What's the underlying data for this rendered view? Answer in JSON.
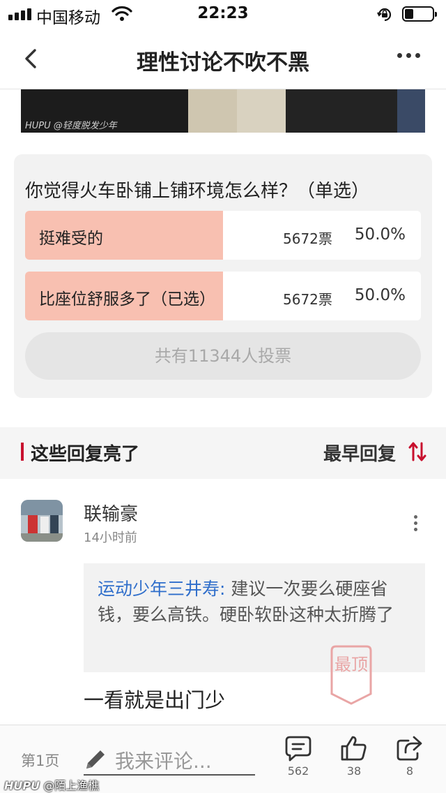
{
  "status_bar": {
    "carrier": "中国移动",
    "time": "22:23",
    "icons": [
      "signal-icon",
      "wifi-icon",
      "rotation-lock-icon",
      "battery-icon"
    ]
  },
  "navbar": {
    "title": "理性讨论不吹不黑",
    "icons": [
      "back-arrow-icon",
      "more-dots-icon"
    ]
  },
  "post_image": {
    "watermark": "HUPU @轻度脱发少年"
  },
  "poll": {
    "question": "你觉得火车卧铺上铺环境怎么样？（单选）",
    "bar_color": "#f8c0b1",
    "options": [
      {
        "label": "挺难受的",
        "votes": "5672票",
        "percent": "50.0%",
        "fraction": 0.5
      },
      {
        "label": "比座位舒服多了（已选）",
        "votes": "5672票",
        "percent": "50.0%",
        "fraction": 0.5
      }
    ],
    "total": "共有11344人投票"
  },
  "section": {
    "title": "这些回复亮了",
    "sort_label": "最早回复",
    "accent": "#c8102e"
  },
  "comment": {
    "user": "联输豪",
    "time": "14小时前",
    "quote_author": "运动少年三井寿:",
    "quote_text": " 建议一次要么硬座省钱，要么高铁。硬卧软卧这种太折腾了",
    "stamp": "最顶",
    "text": "一看就是出门少"
  },
  "bottom_bar": {
    "page": "第1页",
    "placeholder": "我来评论...",
    "reply_count": "562",
    "like_count": "38",
    "share_count": "8"
  },
  "footer_watermark": {
    "brand": "HUPU",
    "handle": "@陌上渔樵"
  }
}
